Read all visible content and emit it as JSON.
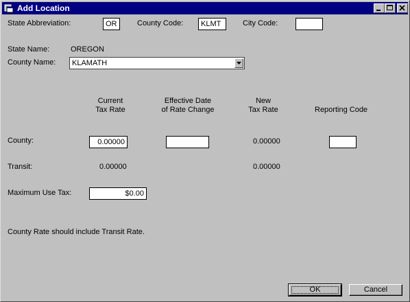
{
  "window": {
    "title": "Add Location"
  },
  "header": {
    "state_abbrev_label": "State Abbreviation:",
    "state_abbrev_value": "OR",
    "county_code_label": "County Code:",
    "county_code_value": "KLMT",
    "city_code_label": "City Code:",
    "city_code_value": "",
    "state_name_label": "State Name:",
    "state_name_value": "OREGON",
    "county_name_label": "County Name:",
    "county_name_value": "KLAMATH"
  },
  "columns": {
    "current_line1": "Current",
    "current_line2": "Tax Rate",
    "effective_line1": "Effective Date",
    "effective_line2": "of Rate Change",
    "new_line1": "New",
    "new_line2": "Tax Rate",
    "reporting": "Reporting Code"
  },
  "rows": {
    "county_label": "County:",
    "county_current": "0.00000",
    "county_effective": "",
    "county_new": "0.00000",
    "county_reporting": "",
    "transit_label": "Transit:",
    "transit_current": "0.00000",
    "transit_new": "0.00000",
    "max_use_tax_label": "Maximum Use Tax:",
    "max_use_tax_value": "$0.00"
  },
  "note": "County Rate should include Transit Rate.",
  "buttons": {
    "ok": "OK",
    "cancel": "Cancel"
  },
  "icons": {
    "app": "app-window-icon",
    "minimize": "minimize-icon",
    "maximize": "maximize-icon",
    "close": "close-icon",
    "dropdown": "chevron-down-icon"
  }
}
